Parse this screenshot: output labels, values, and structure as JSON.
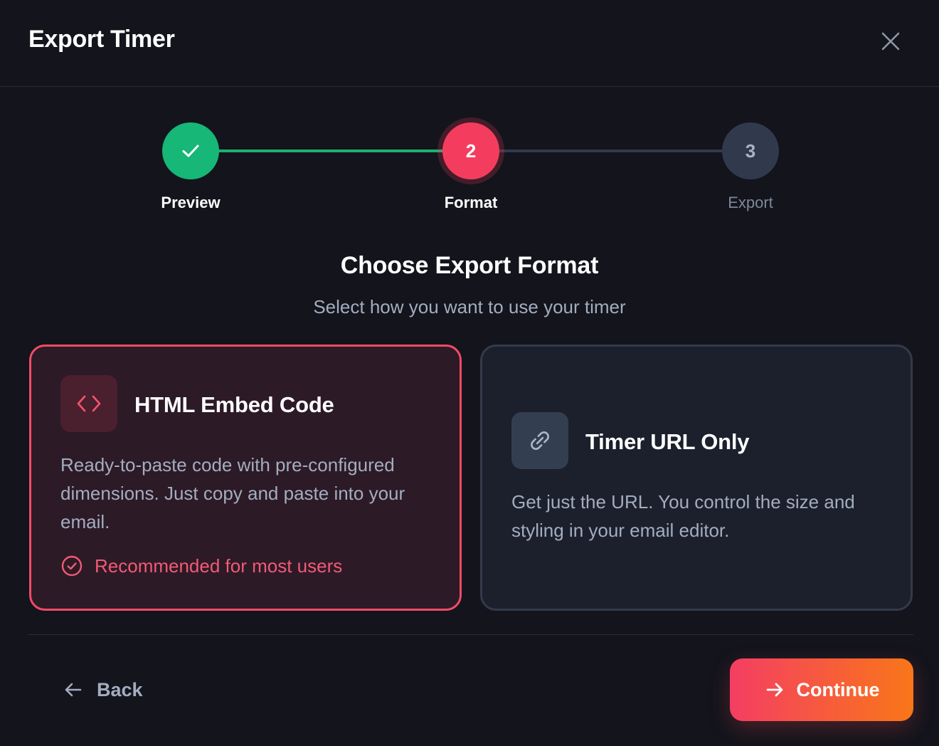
{
  "dialog": {
    "title": "Export Timer",
    "close_icon": "close-icon"
  },
  "stepper": {
    "steps": [
      {
        "label": "Preview",
        "number": "1",
        "status": "completed",
        "icon": "check-icon"
      },
      {
        "label": "Format",
        "number": "2",
        "status": "active"
      },
      {
        "label": "Export",
        "number": "3",
        "status": "upcoming"
      }
    ]
  },
  "section": {
    "title": "Choose Export Format",
    "subtitle": "Select how you want to use your timer"
  },
  "options": {
    "html": {
      "icon": "code-icon",
      "title": "HTML Embed Code",
      "description": "Ready-to-paste code with pre-configured dimensions. Just copy and paste into your email.",
      "badge": "Recommended for most users",
      "badge_icon": "check-circle-icon",
      "selected": true
    },
    "url": {
      "icon": "link-icon",
      "title": "Timer URL Only",
      "description": "Get just the URL. You control the size and styling in your email editor.",
      "selected": false
    }
  },
  "footer": {
    "back_label": "Back",
    "back_icon": "arrow-left-icon",
    "continue_label": "Continue",
    "continue_icon": "arrow-right-icon"
  },
  "colors": {
    "background": "#13141c",
    "success": "#16b777",
    "accent": "#f43d5e",
    "accent_gradient_end": "#f97619",
    "muted": "#a3adbf"
  }
}
